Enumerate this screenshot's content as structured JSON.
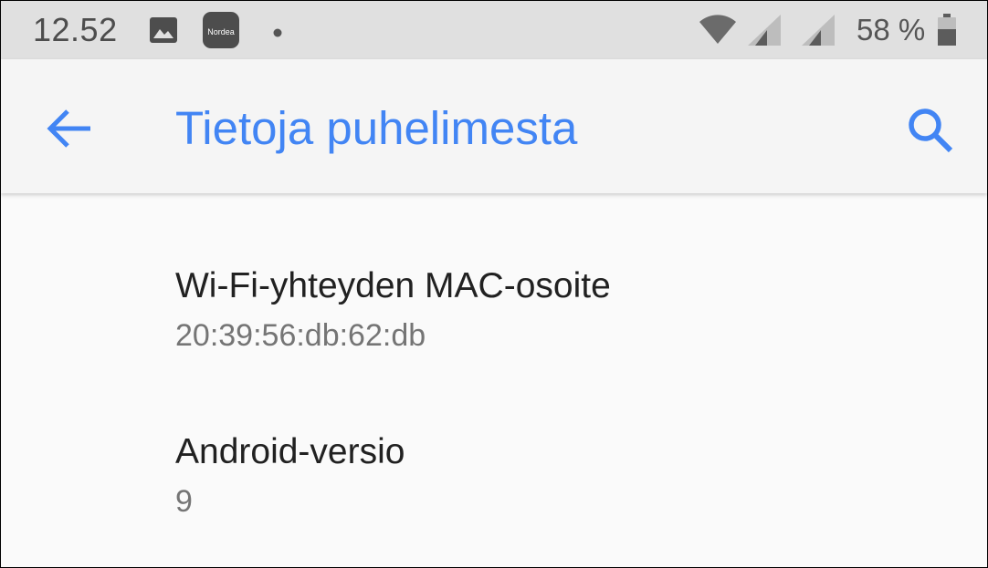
{
  "status_bar": {
    "time": "12.52",
    "notification_icons": [
      "image-icon",
      "nordea-app-icon",
      "more-notifications-dot-icon"
    ],
    "nordea_label": "Nordea",
    "system_icons": [
      "wifi-icon",
      "cell-signal-icon",
      "cell-signal-icon",
      "battery-icon"
    ],
    "battery_percent": "58 %",
    "battery_level": 0.58,
    "background_color": "#e0e0e0"
  },
  "app_bar": {
    "back_icon": "arrow-back-icon",
    "title": "Tietoja puhelimesta",
    "search_icon": "search-icon",
    "accent_color": "#4285f4"
  },
  "preferences": [
    {
      "title": "Wi-Fi-yhteyden MAC-osoite",
      "summary": "20:39:56:db:62:db"
    },
    {
      "title": "Android-versio",
      "summary": "9"
    }
  ]
}
